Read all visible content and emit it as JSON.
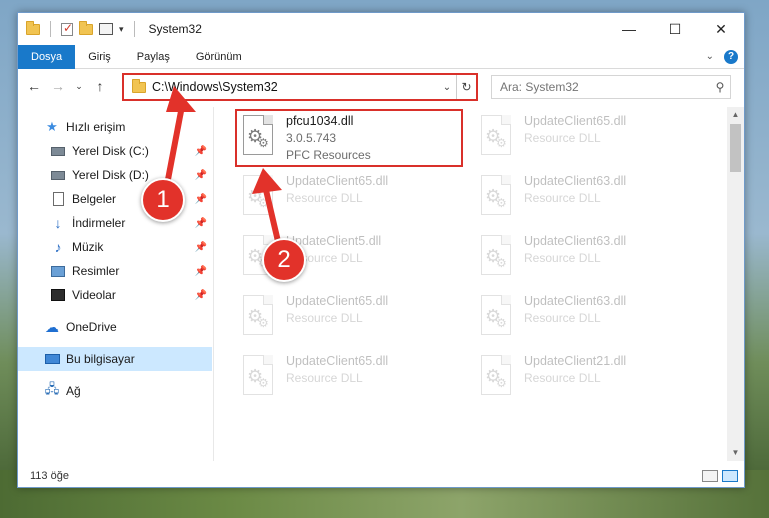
{
  "window": {
    "title": "System32",
    "controls": {
      "minimize": "—",
      "maximize": "☐",
      "close": "✕"
    }
  },
  "ribbon": {
    "tabs": [
      "Dosya",
      "Giriş",
      "Paylaş",
      "Görünüm"
    ],
    "active_tab": "Dosya",
    "help": "?"
  },
  "address": {
    "path": "C:\\Windows\\System32",
    "search_placeholder": "Ara: System32"
  },
  "nav": {
    "items": [
      {
        "label": "Hızlı erişim",
        "icon": "star-icon"
      },
      {
        "label": "Yerel Disk (C:)",
        "icon": "disk-icon",
        "pinned": true
      },
      {
        "label": "Yerel Disk (D:)",
        "icon": "disk-icon",
        "pinned": true
      },
      {
        "label": "Belgeler",
        "icon": "document-icon",
        "pinned": true
      },
      {
        "label": "İndirmeler",
        "icon": "download-icon",
        "pinned": true
      },
      {
        "label": "Müzik",
        "icon": "music-icon",
        "pinned": true
      },
      {
        "label": "Resimler",
        "icon": "pictures-icon",
        "pinned": true
      },
      {
        "label": "Videolar",
        "icon": "video-icon",
        "pinned": true
      },
      {
        "label": "OneDrive",
        "icon": "cloud-icon"
      },
      {
        "label": "Bu bilgisayar",
        "icon": "computer-icon",
        "selected": true
      },
      {
        "label": "Ağ",
        "icon": "network-icon"
      }
    ]
  },
  "files": [
    {
      "name": "pfcu1034.dll",
      "line2": "3.0.5.743",
      "line3": "PFC Resources",
      "highlighted": true
    },
    {
      "name": "UpdateClient65.dll",
      "line2": "Resource DLL"
    },
    {
      "name": "UpdateClient65.dll",
      "line2": "Resource DLL"
    },
    {
      "name": "UpdateClient63.dll",
      "line2": "Resource DLL"
    },
    {
      "name": "UpdateClient5.dll",
      "line2": "Resource DLL"
    },
    {
      "name": "UpdateClient63.dll",
      "line2": "Resource DLL"
    },
    {
      "name": "UpdateClient65.dll",
      "line2": "Resource DLL"
    },
    {
      "name": "UpdateClient63.dll",
      "line2": "Resource DLL"
    },
    {
      "name": "UpdateClient65.dll",
      "line2": "Resource DLL"
    },
    {
      "name": "UpdateClient21.dll",
      "line2": "Resource DLL"
    }
  ],
  "status": {
    "count": "113 öğe"
  },
  "callouts": [
    "1",
    "2"
  ],
  "colors": {
    "accent": "#1979ca",
    "highlight_border": "#d9302a",
    "callout": "#e2322a",
    "selected_bg": "#cce8ff"
  }
}
